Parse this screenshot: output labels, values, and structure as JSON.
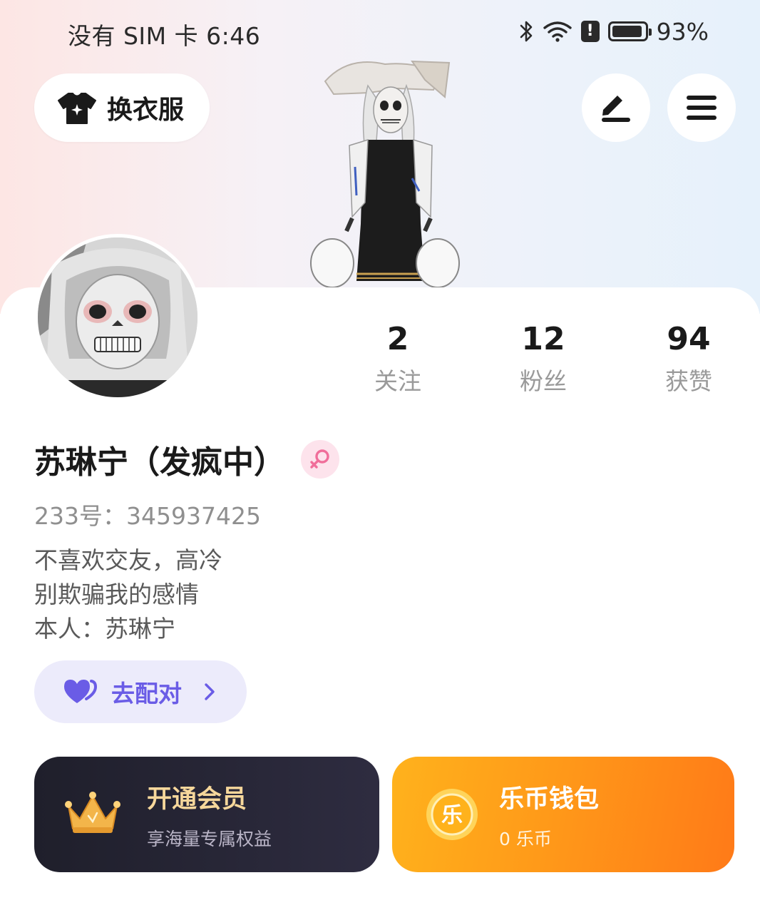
{
  "status_bar": {
    "carrier_time": "没有 SIM 卡 6:46",
    "battery_percent": "93%",
    "battery_level": 0.93,
    "icons": [
      "bluetooth-icon",
      "wifi-icon",
      "alert-icon",
      "battery-icon"
    ]
  },
  "header": {
    "outfit_label": "换衣服",
    "outfit_icon": "tshirt-icon",
    "edit_icon": "pen-icon",
    "menu_icon": "hamburger-menu-icon"
  },
  "stats": [
    {
      "value": "2",
      "label": "关注"
    },
    {
      "value": "12",
      "label": "粉丝"
    },
    {
      "value": "94",
      "label": "获赞"
    }
  ],
  "profile": {
    "nickname": "苏琳宁（发疯中）",
    "gender": "female",
    "gender_icon": "female-symbol-icon",
    "user_id": "233号：345937425",
    "bio": [
      "不喜欢交友，高冷",
      "别欺骗我的感情",
      "本人：苏琳宁"
    ]
  },
  "match": {
    "label": "去配对",
    "icon": "heart-icon"
  },
  "vip_card": {
    "title": "开通会员",
    "subtitle": "享海量专属权益",
    "icon": "crown-icon"
  },
  "wallet_card": {
    "title": "乐币钱包",
    "subtitle": "0 乐币",
    "coin_char": "乐",
    "icon": "coin-icon"
  },
  "colors": {
    "accent_purple": "#6a5ce6",
    "vip_gold": "#f6d79b",
    "wallet_orange": "#ff9a19",
    "gender_pink": "#f06e9a"
  }
}
